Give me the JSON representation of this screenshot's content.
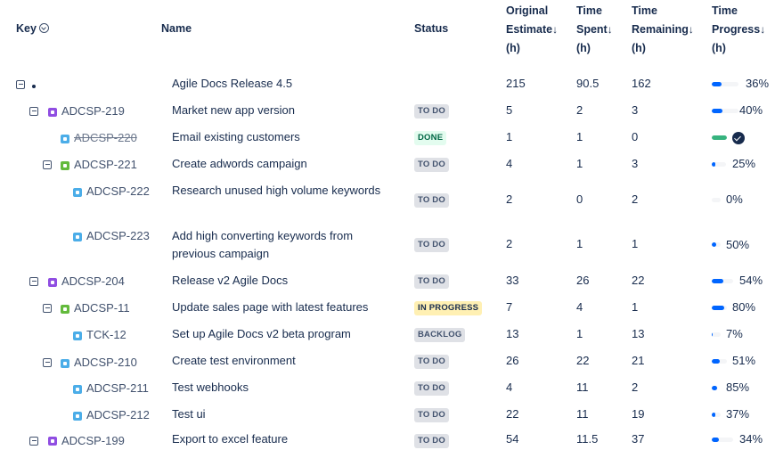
{
  "columns": {
    "key": "Key",
    "name": "Name",
    "status": "Status",
    "original_estimate": [
      "Original",
      "Estimate",
      "(h)"
    ],
    "time_spent": [
      "Time",
      "Spent",
      "(h)"
    ],
    "time_remaining": [
      "Time",
      "Remaining",
      "(h)"
    ],
    "time_progress": [
      "Time",
      "Progress",
      "(h)"
    ],
    "sort_arrow": "↓"
  },
  "rows": [
    {
      "key": "",
      "name": "Agile Docs Release 4.5",
      "status": "",
      "estimate": "215",
      "spent": "90.5",
      "remaining": "162",
      "progress": 0.36,
      "progress_label": "36%"
    },
    {
      "key": "ADCSP-219",
      "type": "epic",
      "name": "Market new app version",
      "status": "TO DO",
      "estimate": "5",
      "spent": "2",
      "remaining": "3",
      "progress": 0.4,
      "progress_label": "40%"
    },
    {
      "key": "ADCSP-220",
      "type": "subtask",
      "name": "Email existing customers",
      "status": "DONE",
      "estimate": "1",
      "spent": "1",
      "remaining": "0",
      "progress": 1.0,
      "progress_label": ""
    },
    {
      "key": "ADCSP-221",
      "type": "story",
      "name": "Create adwords campaign",
      "status": "TO DO",
      "estimate": "4",
      "spent": "1",
      "remaining": "3",
      "progress": 0.25,
      "progress_label": "25%"
    },
    {
      "key": "ADCSP-222",
      "type": "task",
      "name": "Research unused high volume keywords",
      "status": "TO DO",
      "estimate": "2",
      "spent": "0",
      "remaining": "2",
      "progress": 0.0,
      "progress_label": "0%"
    },
    {
      "key": "ADCSP-223",
      "type": "task",
      "name": "Add high converting keywords from previous campaign",
      "status": "TO DO",
      "estimate": "2",
      "spent": "1",
      "remaining": "1",
      "progress": 0.5,
      "progress_label": "50%"
    },
    {
      "key": "ADCSP-204",
      "type": "epic",
      "name": "Release v2 Agile Docs",
      "status": "TO DO",
      "estimate": "33",
      "spent": "26",
      "remaining": "22",
      "progress": 0.54,
      "progress_label": "54%"
    },
    {
      "key": "ADCSP-11",
      "type": "story",
      "name": "Update sales page with latest features",
      "status": "IN PROGRESS",
      "estimate": "7",
      "spent": "4",
      "remaining": "1",
      "progress": 0.8,
      "progress_label": "80%"
    },
    {
      "key": "TCK-12",
      "type": "subtask",
      "name": "Set up Agile Docs v2 beta program",
      "status": "BACKLOG",
      "estimate": "13",
      "spent": "1",
      "remaining": "13",
      "progress": 0.07,
      "progress_label": "7%"
    },
    {
      "key": "ADCSP-210",
      "type": "subtask",
      "name": "Create test environment",
      "status": "TO DO",
      "estimate": "26",
      "spent": "22",
      "remaining": "21",
      "progress": 0.51,
      "progress_label": "51%"
    },
    {
      "key": "ADCSP-211",
      "type": "task",
      "name": "Test webhooks",
      "status": "TO DO",
      "estimate": "4",
      "spent": "11",
      "remaining": "2",
      "progress": 0.85,
      "progress_label": "85%"
    },
    {
      "key": "ADCSP-212",
      "type": "task",
      "name": "Test ui",
      "status": "TO DO",
      "estimate": "22",
      "spent": "11",
      "remaining": "19",
      "progress": 0.37,
      "progress_label": "37%"
    },
    {
      "key": "ADCSP-199",
      "type": "epic",
      "name": "Export to excel feature",
      "status": "TO DO",
      "estimate": "54",
      "spent": "11.5",
      "remaining": "37",
      "progress": 0.34,
      "progress_label": "34%"
    }
  ]
}
